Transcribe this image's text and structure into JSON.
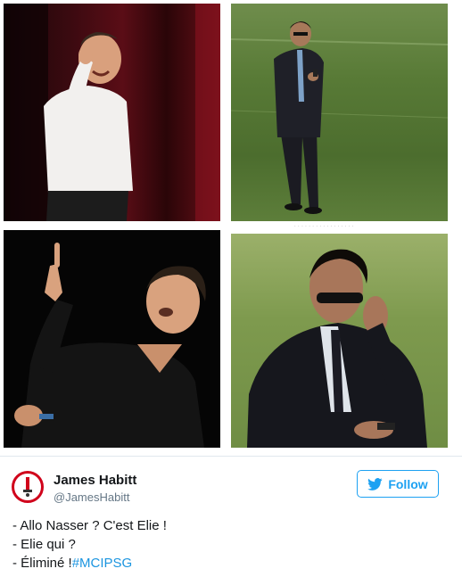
{
  "photos": [
    {
      "label": "comedian-on-phone-photo"
    },
    {
      "label": "man-walking-pitch-photo"
    },
    {
      "label": "comedian-pointing-photo"
    },
    {
      "label": "man-sunglasses-phone-photo"
    }
  ],
  "tweet": {
    "author_name": "James Habitt",
    "author_handle": "@JamesHabitt",
    "follow_label": "Follow",
    "lines": [
      "- Allo Nasser ? C'est Elie !",
      "- Elie qui ?",
      "- Éliminé !"
    ],
    "hashtag": "#MCIPSG"
  },
  "colors": {
    "accent": "#1da1f2",
    "hashtag": "#1b95e0",
    "avatar_border": "#d0021b"
  },
  "icons": {
    "close": "close-icon",
    "follow": "twitter-bird-icon"
  }
}
